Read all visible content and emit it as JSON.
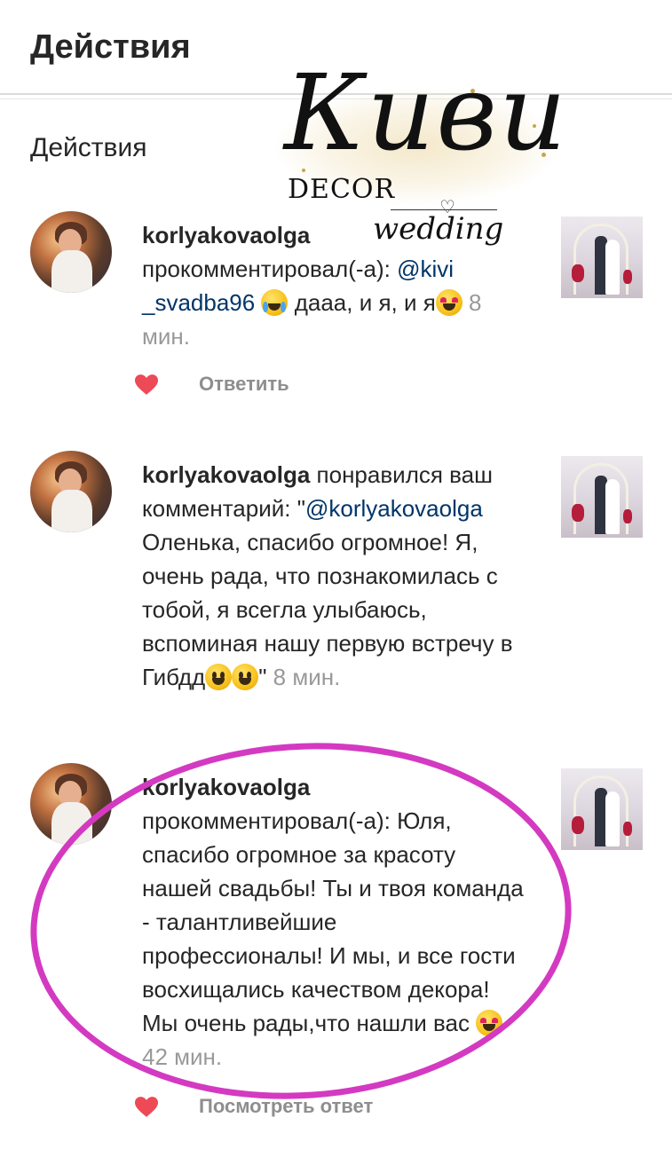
{
  "header": {
    "title": "Действия"
  },
  "section": {
    "title": "Действия"
  },
  "watermark": {
    "main": "Киви",
    "line1": "DECOR",
    "line2": "wedding"
  },
  "notifications": [
    {
      "username": "korlyakovaolga",
      "pre": " прокомментировал(-а): ",
      "mention": "@kivi _svadba96",
      "text_a": " ",
      "text_b": " дааа, и я, и я",
      "time": " 8 мин.",
      "action_label": "Ответить"
    },
    {
      "username": "korlyakovaolga",
      "pre": " понравился ваш комментарий: \"",
      "mention": "@korlyakovaolga",
      "text_a": " Оленька, спасибо огромное! Я, очень рада, что познакомилась с тобой, я всегла улыбаюсь, вспоминая нашу первую встречу в Гибдд",
      "text_b": "\"",
      "time": " 8 мин."
    },
    {
      "username": "korlyakovaolga",
      "pre": " прокомментировал(-а): Юля, спасибо огромное за красоту нашей свадьбы! Ты и твоя команда - талантливейшие профессионалы! И мы, и все гости восхищались качеством декора! Мы очень рады,что нашли вас ",
      "time": " 42 мин.",
      "action_label": "Посмотреть ответ"
    }
  ],
  "colors": {
    "heart": "#ed4956",
    "highlight": "#d33ac1",
    "mention": "#003569",
    "muted": "#999999"
  }
}
